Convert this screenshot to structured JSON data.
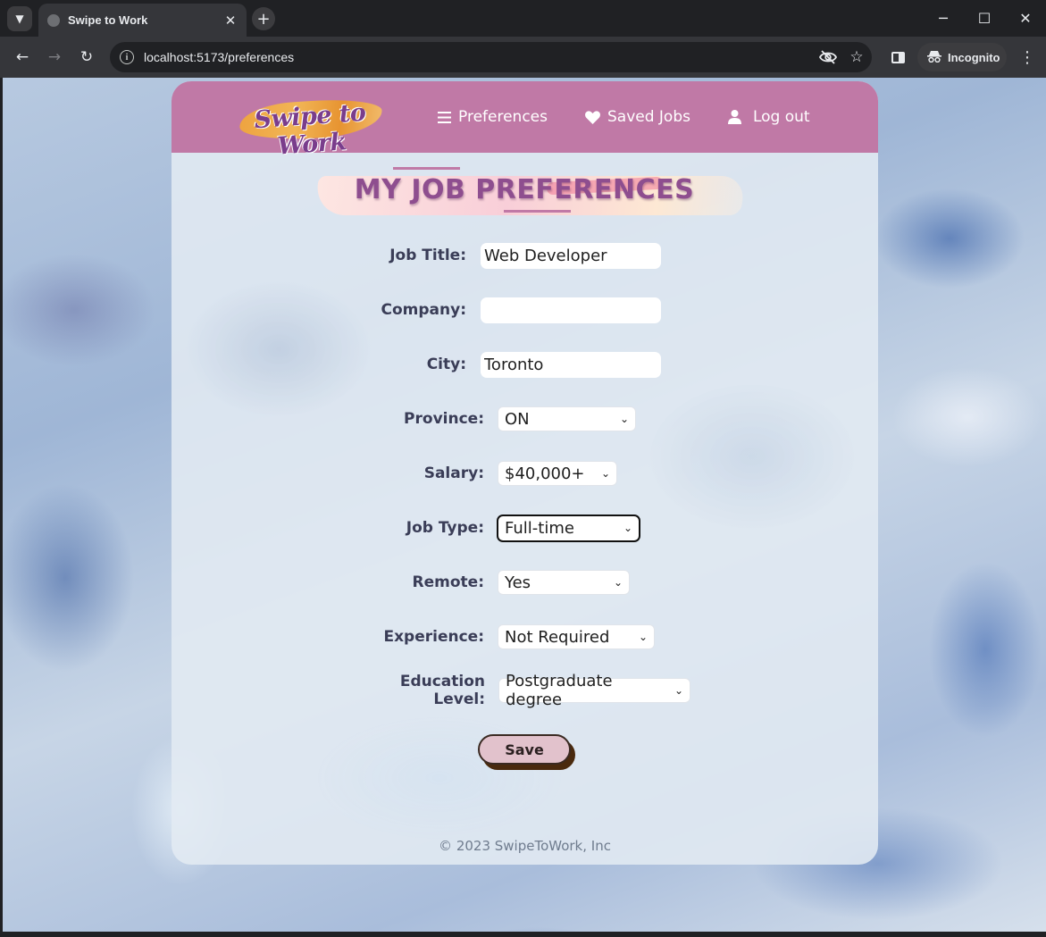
{
  "browser": {
    "tab_title": "Swipe to Work",
    "tab_close": "✕",
    "new_tab": "+",
    "url": "localhost:5173/preferences",
    "incognito_label": "Incognito",
    "window_controls": {
      "minimize": "─",
      "maximize": "☐",
      "close": "✕"
    }
  },
  "navbar": {
    "logo_text": "Swipe to Work",
    "links": [
      {
        "label": "Preferences",
        "icon": "menu-icon"
      },
      {
        "label": "Saved Jobs",
        "icon": "heart-icon"
      },
      {
        "label": "Log out",
        "icon": "user-icon"
      }
    ]
  },
  "page": {
    "title": "MY JOB PREFERENCES"
  },
  "form": {
    "job_title": {
      "label": "Job Title:",
      "value": "Web Developer"
    },
    "company": {
      "label": "Company:",
      "value": ""
    },
    "city": {
      "label": "City:",
      "value": "Toronto"
    },
    "province": {
      "label": "Province:",
      "value": "ON"
    },
    "salary": {
      "label": "Salary:",
      "value": "$40,000+"
    },
    "job_type": {
      "label": "Job Type:",
      "value": "Full-time"
    },
    "remote": {
      "label": "Remote:",
      "value": "Yes"
    },
    "experience": {
      "label": "Experience:",
      "value": "Not Required"
    },
    "education": {
      "label": "Education Level:",
      "value": "Postgraduate degree"
    },
    "save_label": "Save"
  },
  "footer": {
    "copyright": "© 2023 SwipeToWork, Inc"
  },
  "colors": {
    "navbar": "#c079a6",
    "title": "#8e4e8f",
    "label": "#3a3d57",
    "save_button": "#e2c2cc"
  }
}
